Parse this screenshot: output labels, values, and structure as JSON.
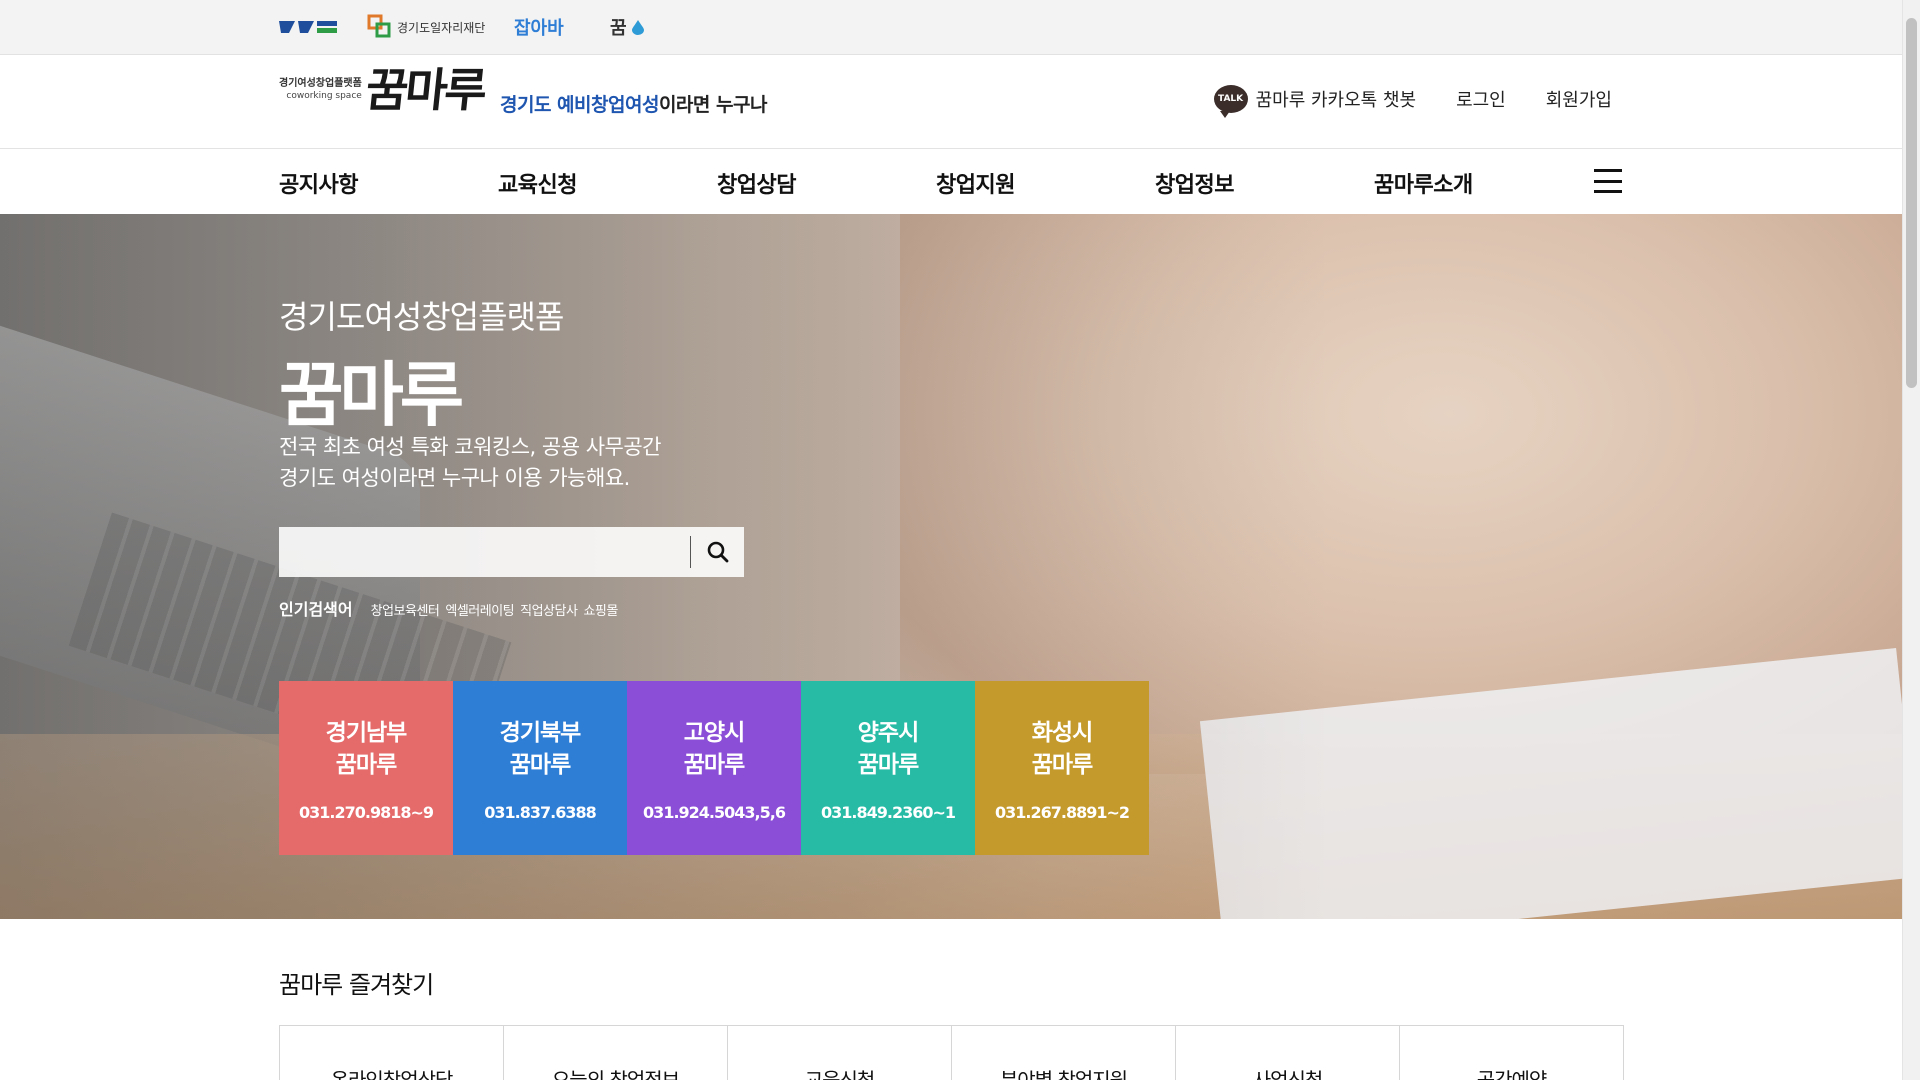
{
  "util_bar": {
    "logos": [
      {
        "name": "gyeonggi-logo",
        "label": ""
      },
      {
        "name": "job-foundation-logo",
        "label": "경기도일자리재단"
      },
      {
        "name": "jobaba-logo",
        "label": "잡아바"
      },
      {
        "name": "kkummaru-small-logo",
        "label": "꿈"
      }
    ]
  },
  "header": {
    "brand_small_line1": "경기여성창업플랫폼",
    "brand_small_line2": "coworking space",
    "brand_main": "꿈마루",
    "tagline_highlight": "경기도 예비창업여성",
    "tagline_rest": "이라면 누구나",
    "kakao_badge": "TALK",
    "kakao_label": "꿈마루 카카오톡 챗봇",
    "login": "로그인",
    "signup": "회원가입"
  },
  "gnb": {
    "items": [
      "공지사항",
      "교육신청",
      "창업상담",
      "창업지원",
      "창업정보",
      "꿈마루소개"
    ]
  },
  "hero": {
    "subtitle": "경기도여성창업플랫폼",
    "title": "꿈마루",
    "desc_line1": "전국 최초 여성 특화 코워킹스, 공용 사무공간",
    "desc_line2": "경기도 여성이라면 누구나 이용 가능해요.",
    "search_value": "",
    "popular_label": "인기검색어",
    "popular_keywords": [
      "창업보육센터",
      "엑셀러레이팅",
      "직업상담사",
      "쇼핑몰"
    ]
  },
  "centers": [
    {
      "line1": "경기남부",
      "line2": "꿈마루",
      "tel": "031.270.9818~9",
      "color": "#e56a6a"
    },
    {
      "line1": "경기북부",
      "line2": "꿈마루",
      "tel": "031.837.6388",
      "color": "#2f7ed6"
    },
    {
      "line1": "고양시",
      "line2": "꿈마루",
      "tel": "031.924.5043,5,6",
      "color": "#8a4fd6"
    },
    {
      "line1": "양주시",
      "line2": "꿈마루",
      "tel": "031.849.2360~1",
      "color": "#27bba6"
    },
    {
      "line1": "화성시",
      "line2": "꿈마루",
      "tel": "031.267.8891~2",
      "color": "#c39a2b"
    }
  ],
  "favorites": {
    "title": "꿈마루 즐겨찾기",
    "items": [
      "온라인창업상담",
      "오늘의 창업정보",
      "교육신청",
      "분야별 창업지원",
      "사업신청",
      "공간예약"
    ]
  }
}
